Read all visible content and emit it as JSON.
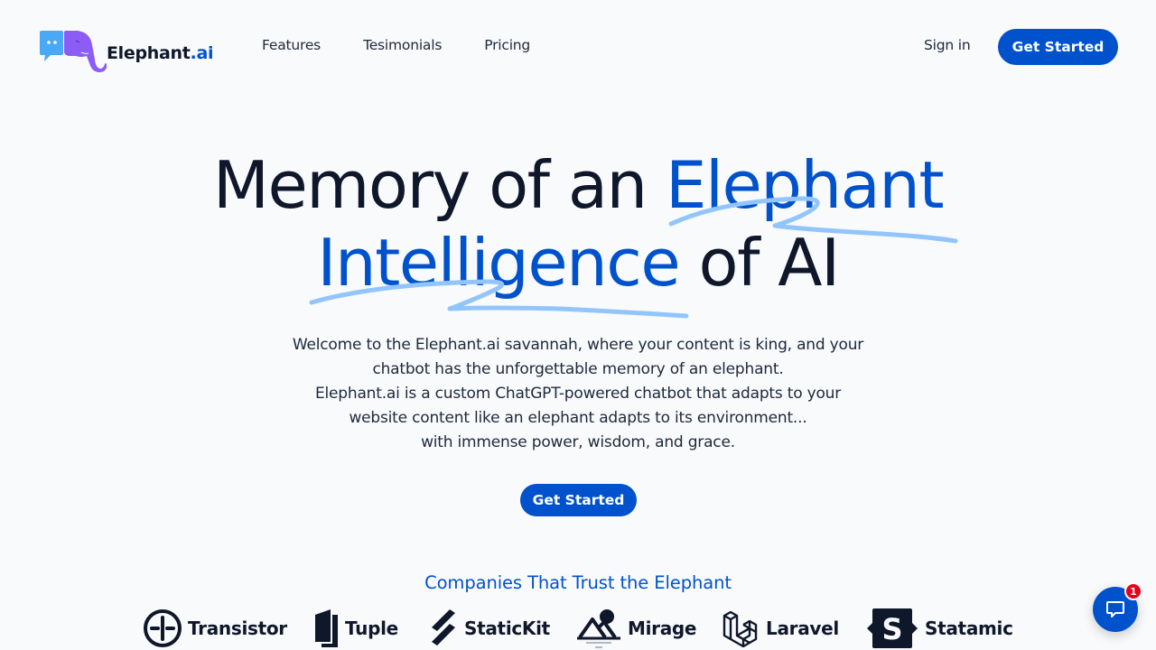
{
  "header": {
    "brand_name": "Elephant",
    "brand_suffix": ".ai",
    "nav": [
      {
        "label": "Features"
      },
      {
        "label": "Tesimonials"
      },
      {
        "label": "Pricing"
      }
    ],
    "sign_in_label": "Sign in",
    "cta_label": "Get Started"
  },
  "hero": {
    "title_part1": "Memory of an ",
    "title_highlight1": "Elephant",
    "title_highlight2": "Intelligence",
    "title_part2": " of AI",
    "description_lines": [
      "Welcome to the Elephant.ai savannah, where your content is king, and your",
      "chatbot has the unforgettable memory of an elephant.",
      "Elephant.ai is a custom ChatGPT-powered chatbot that adapts to your",
      "website content like an elephant adapts to its environment...",
      "with immense power, wisdom, and grace."
    ],
    "cta_label": "Get Started"
  },
  "trust": {
    "title": "Companies That Trust the Elephant",
    "companies": [
      {
        "name": "Transistor",
        "icon": "transistor-icon"
      },
      {
        "name": "Tuple",
        "icon": "tuple-icon"
      },
      {
        "name": "StaticKit",
        "icon": "statickit-icon"
      },
      {
        "name": "Mirage",
        "icon": "mirage-icon"
      },
      {
        "name": "Laravel",
        "icon": "laravel-icon"
      },
      {
        "name": "Statamic",
        "icon": "statamic-icon"
      }
    ]
  },
  "chat_widget": {
    "icon": "chat-bubble-icon",
    "badge_count": "1"
  },
  "colors": {
    "brand_blue": "#0052cc",
    "squiggle_blue": "#93c5fd",
    "text_dark": "#0f172a",
    "background": "#f8fafc",
    "badge_red": "#e5001b",
    "logo_bubble_blue": "#4aa8f5",
    "logo_elephant_purple": "#8b5cf6"
  }
}
